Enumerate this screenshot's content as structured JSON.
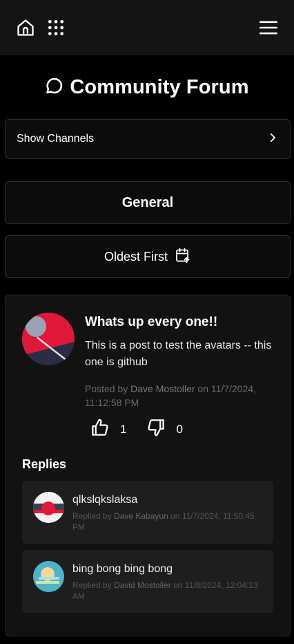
{
  "topbar": {
    "home_icon": "home-icon",
    "apps_icon": "grid-dots-icon",
    "menu_icon": "hamburger-menu-icon"
  },
  "page": {
    "title": "Community Forum",
    "title_icon": "chat-bubble-icon"
  },
  "channels_button": {
    "label": "Show Channels",
    "icon": "chevron-right-icon"
  },
  "channel": {
    "name": "General"
  },
  "sort": {
    "label": "Oldest First",
    "icon": "calendar-arrow-up-icon"
  },
  "post": {
    "title": "Whats up every one!!",
    "content": "This is a post to test the avatars -- this one is github",
    "posted_by_prefix": "Posted by",
    "author": "Dave Mostoller",
    "on_word": "on",
    "timestamp": "11/7/2024, 11:12:58 PM",
    "likes": "1",
    "dislikes": "0"
  },
  "replies": {
    "heading": "Replies",
    "replied_by_prefix": "Replied by",
    "on_word": "on",
    "items": [
      {
        "text": "qlkslqkslaksa",
        "author": "Dave Kabayun",
        "timestamp": "11/7/2024, 11:50:45 PM"
      },
      {
        "text": "bing bong bing bong",
        "author": "David Mostoller",
        "timestamp": "11/8/2024, 12:04:13 AM"
      }
    ]
  },
  "colors": {
    "background": "#000000",
    "topbar": "#141414",
    "card": "#121212",
    "reply_card": "#1e1e1e",
    "muted_text": "#6b6b6b",
    "avatar_red": "#e0193a",
    "avatar_navy": "#2b2d45",
    "avatar_teal": "#4fb3c8"
  }
}
